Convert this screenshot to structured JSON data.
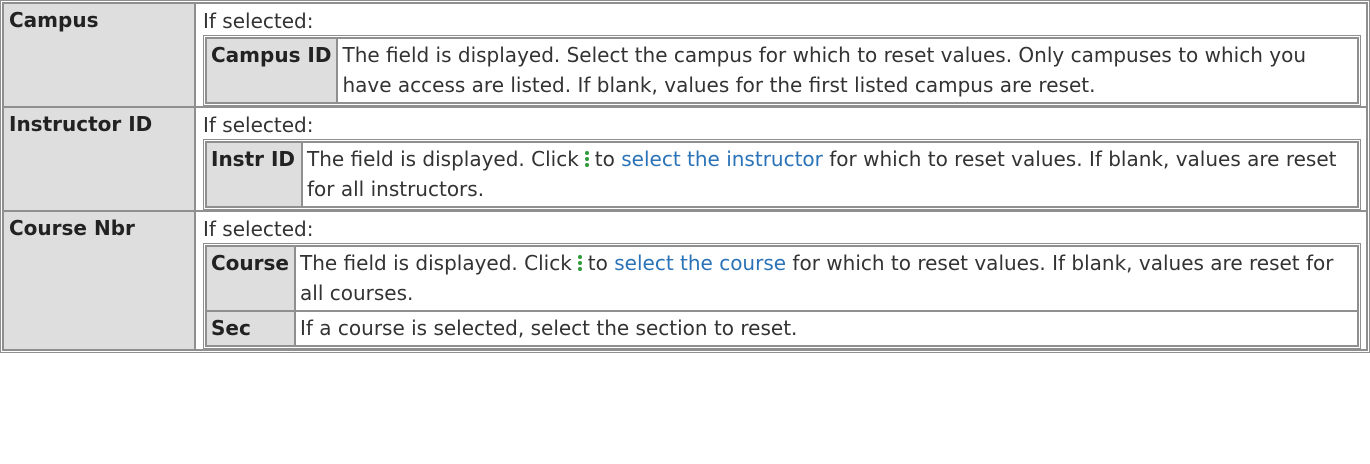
{
  "rows": [
    {
      "label": "Campus",
      "condition": "If selected:",
      "sub_label": "Campus ID",
      "sub_text": "The field is displayed. Select the campus for which to reset values. Only campuses to which you have access are listed. If blank, values for the first listed campus are reset."
    },
    {
      "label": "Instructor ID",
      "condition": "If selected:",
      "sub_label": "Instr ID",
      "sub_text_before": "The field is displayed. Click",
      "sub_text_to": "to",
      "sub_link": "select the instructor",
      "sub_text_after": "for which to reset values. If blank, values are reset for all instructors."
    },
    {
      "label": "Course Nbr",
      "condition": "If selected:",
      "sub_label": "Course",
      "sub_text_before": "The field is displayed. Click",
      "sub_text_to": "to",
      "sub_link": "select the course",
      "sub_text_after": "for which to reset values. If blank, values are reset for all courses.",
      "sub2_label": "Sec",
      "sub2_text": "If a course is selected, select the section to reset."
    }
  ],
  "icon": "more-vertical-icon",
  "colors": {
    "link": "#2b73b7",
    "icon": "#2e9a3a",
    "label_bg": "#dedede",
    "border": "#8f8f8f"
  }
}
